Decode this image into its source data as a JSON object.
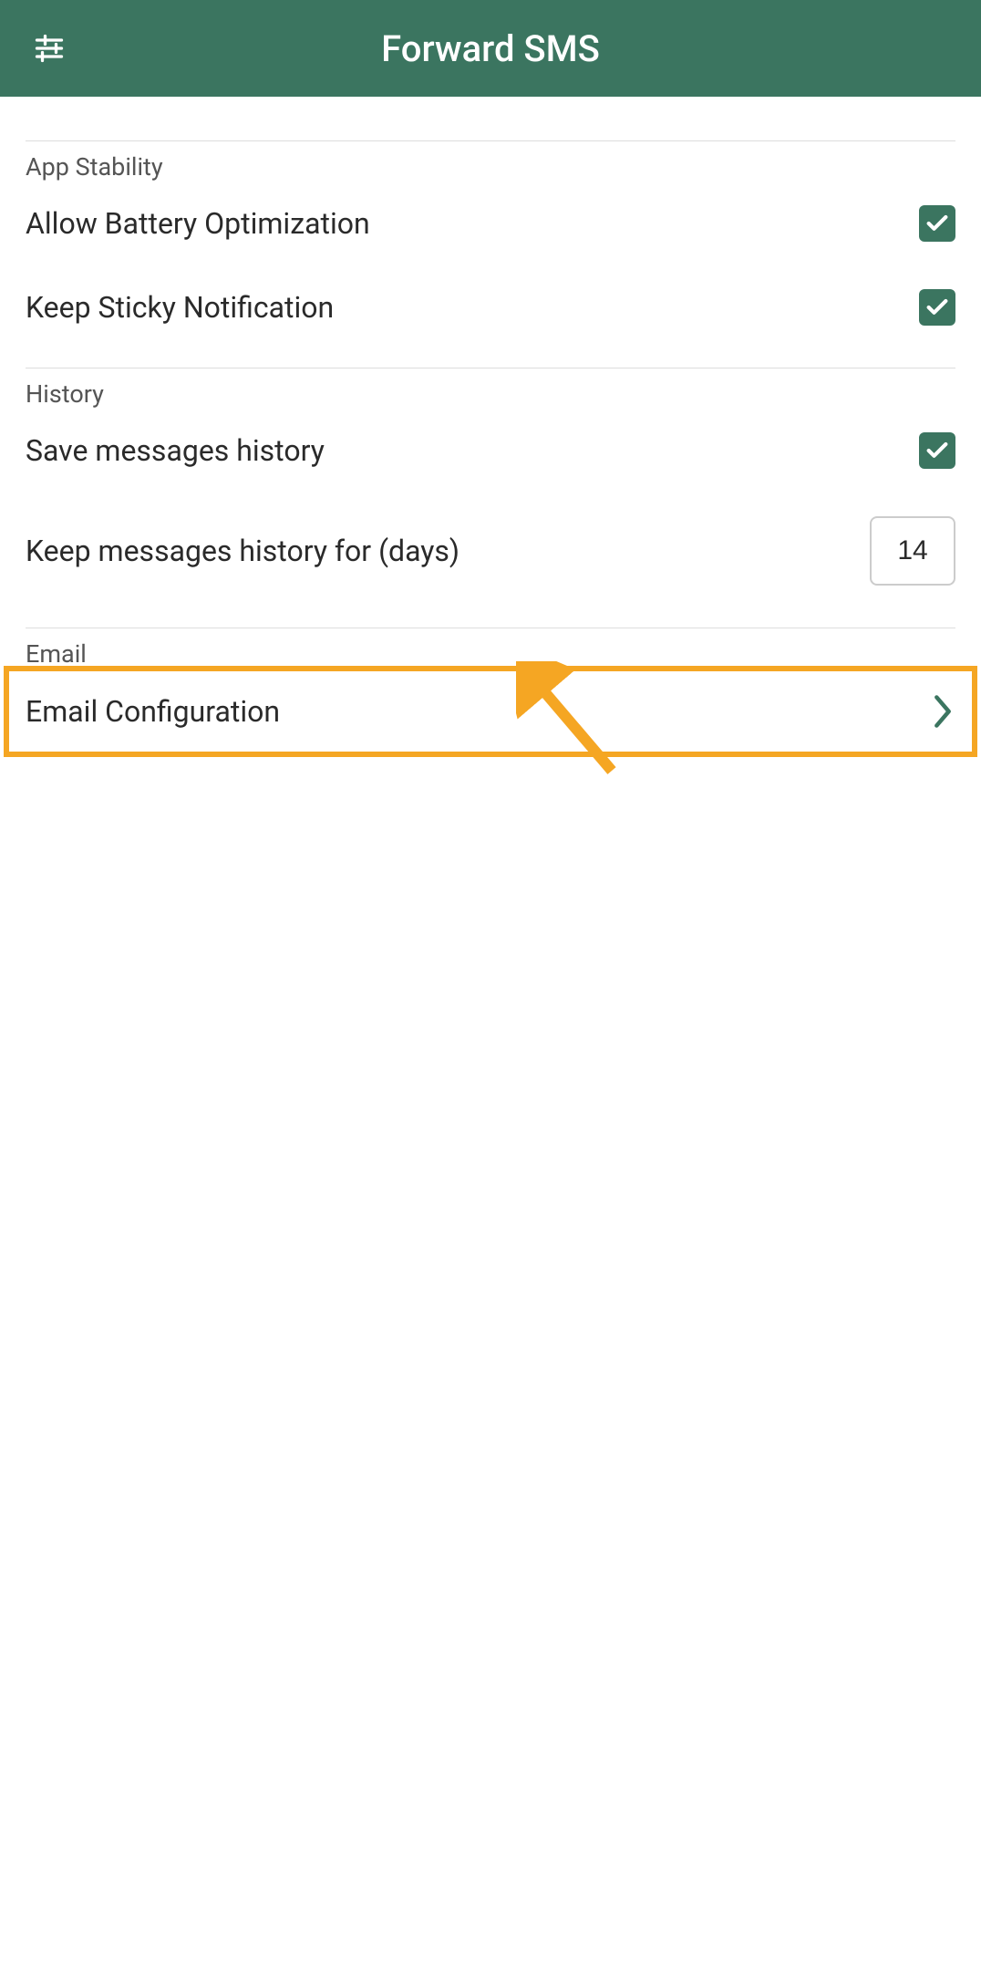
{
  "header": {
    "title": "Forward SMS"
  },
  "sections": {
    "stability": {
      "header": "App Stability",
      "battery_opt_label": "Allow Battery Optimization",
      "sticky_notif_label": "Keep Sticky Notification"
    },
    "history": {
      "header": "History",
      "save_history_label": "Save messages history",
      "keep_days_label": "Keep messages history for (days)",
      "keep_days_value": "14"
    },
    "email": {
      "header": "Email",
      "config_label": "Email Configuration"
    }
  },
  "colors": {
    "primary": "#3b7560",
    "highlight": "#f5a623"
  }
}
